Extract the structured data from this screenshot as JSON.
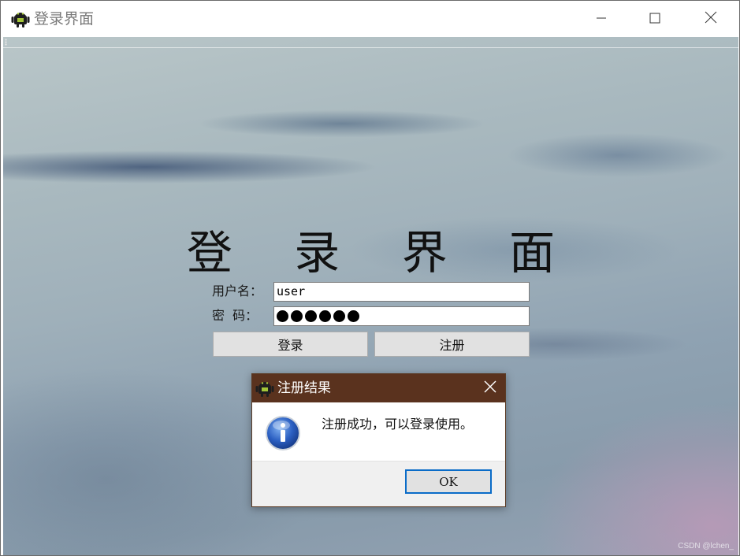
{
  "window": {
    "title": "登录界面",
    "icon": "android-icon",
    "controls": [
      "minimize-icon",
      "maximize-icon",
      "close-icon"
    ]
  },
  "form": {
    "heading": "登 录 界 面",
    "username_label": "用户名：",
    "username_value": "user",
    "password_label": "密  码：",
    "password_mask_count": 6,
    "login_button": "登录",
    "register_button": "注册"
  },
  "dialog": {
    "title": "注册结果",
    "icon": "android-icon",
    "message_icon": "info-icon",
    "message": "注册成功，可以登录使用。",
    "ok_button": "OK"
  },
  "watermark": "CSDN @lchen_",
  "colors": {
    "dialog_titlebar": "#5a321e",
    "ok_focus_border": "#0a6cc8",
    "button_face": "#e1e1e1"
  }
}
